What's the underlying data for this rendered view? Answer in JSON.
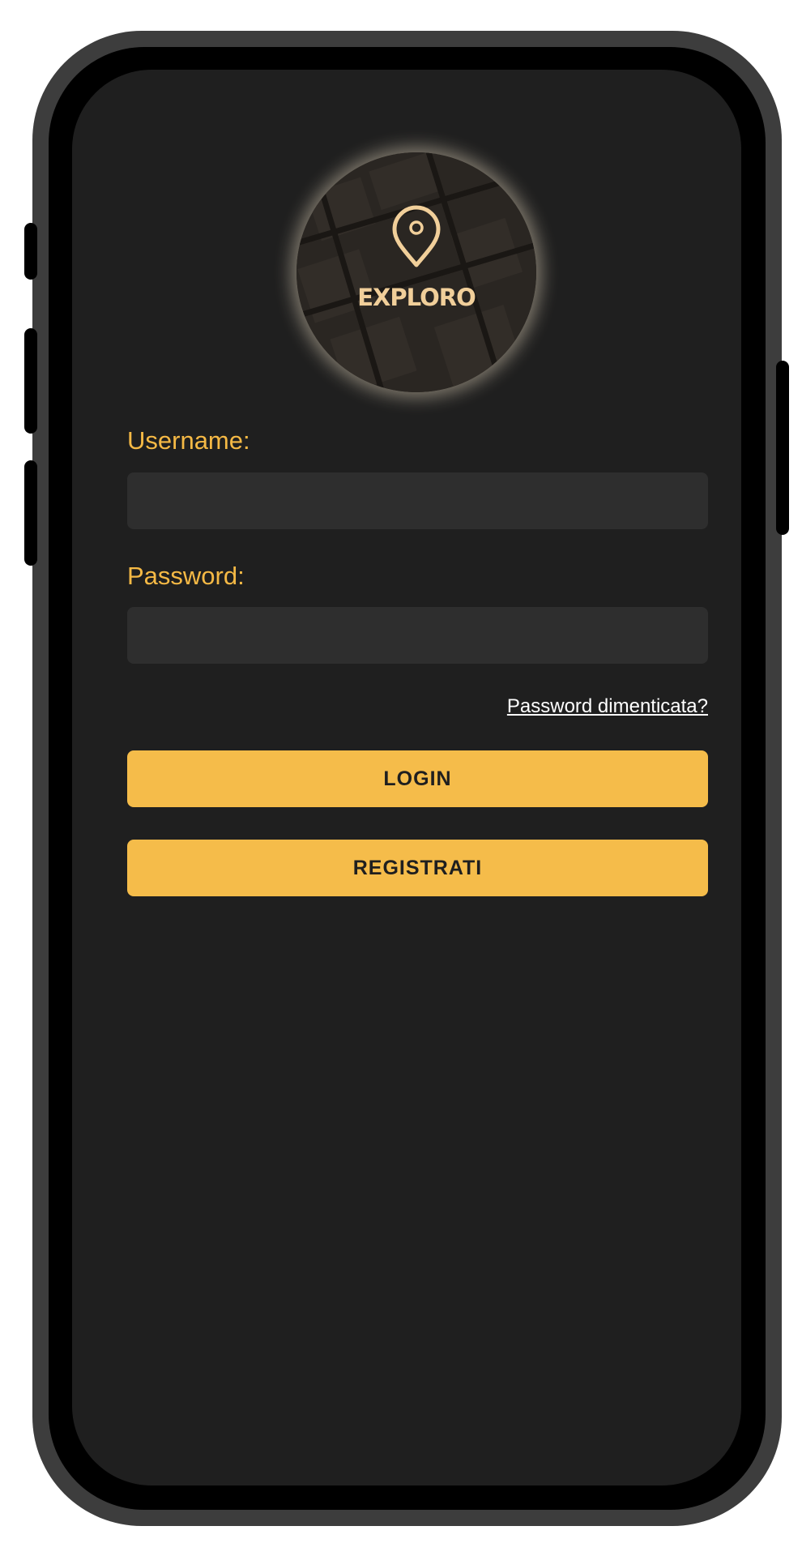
{
  "app": {
    "logo_text": "EXPLORO",
    "logo_icon": "map-pin-icon"
  },
  "form": {
    "username_label": "Username:",
    "username_value": "",
    "password_label": "Password:",
    "password_value": "",
    "forgot_password_link": "Password dimenticata?",
    "login_button": "LOGIN",
    "register_button": "REGISTRATI"
  },
  "colors": {
    "accent": "#f5bc4a",
    "screen_background": "#1f1f1f",
    "input_background": "#2e2e2e",
    "logo_text": "#f1cf9a"
  }
}
